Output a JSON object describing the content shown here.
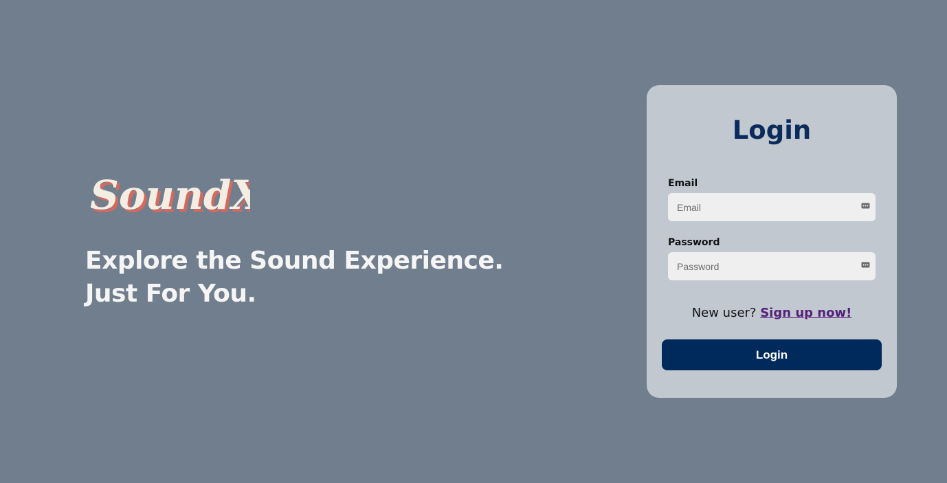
{
  "brand": {
    "logo_text": "SoundX",
    "tagline_line1": "Explore the Sound Experience.",
    "tagline_line2": "Just For You."
  },
  "login_card": {
    "title": "Login",
    "email": {
      "label": "Email",
      "placeholder": "Email",
      "value": ""
    },
    "password": {
      "label": "Password",
      "placeholder": "Password",
      "value": ""
    },
    "signup_prompt": "New user?",
    "signup_link": "Sign up now!",
    "submit_label": "Login"
  },
  "icons": {
    "field_autofill": "key-icon"
  },
  "colors": {
    "background": "#707e8d",
    "card": "#c2c8d0",
    "title": "#0b2b5c",
    "button": "#002a5c",
    "link": "#55207a",
    "logo_fill": "#f3ede3",
    "logo_shadow": "#d46a5e"
  }
}
